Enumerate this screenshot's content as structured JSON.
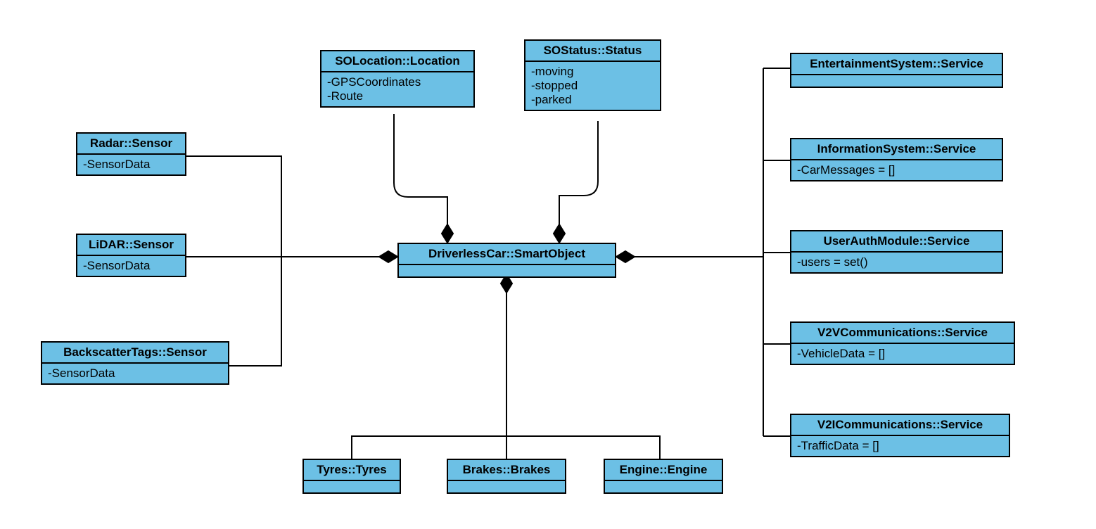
{
  "central": {
    "title": "DriverlessCar::SmartObject"
  },
  "top": {
    "location": {
      "title": "SOLocation::Location",
      "attrs": [
        "-GPSCoordinates",
        "-Route"
      ]
    },
    "status": {
      "title": "SOStatus::Status",
      "attrs": [
        "-moving",
        "-stopped",
        "-parked"
      ]
    }
  },
  "left_sensors": {
    "radar": {
      "title": "Radar::Sensor",
      "attr": "-SensorData"
    },
    "lidar": {
      "title": "LiDAR::Sensor",
      "attr": "-SensorData"
    },
    "backscatter": {
      "title": "BackscatterTags::Sensor",
      "attr": "-SensorData"
    }
  },
  "bottom": {
    "tyres": {
      "title": "Tyres::Tyres"
    },
    "brakes": {
      "title": "Brakes::Brakes"
    },
    "engine": {
      "title": "Engine::Engine"
    }
  },
  "right_services": {
    "entertainment": {
      "title": "EntertainmentSystem::Service"
    },
    "information": {
      "title": "InformationSystem::Service",
      "attr": "-CarMessages = []"
    },
    "userauth": {
      "title": "UserAuthModule::Service",
      "attr": "-users = set()"
    },
    "v2v": {
      "title": "V2VCommunications::Service",
      "attr": "-VehicleData = []"
    },
    "v2i": {
      "title": "V2ICommunications::Service",
      "attr": "-TrafficData = []"
    }
  }
}
